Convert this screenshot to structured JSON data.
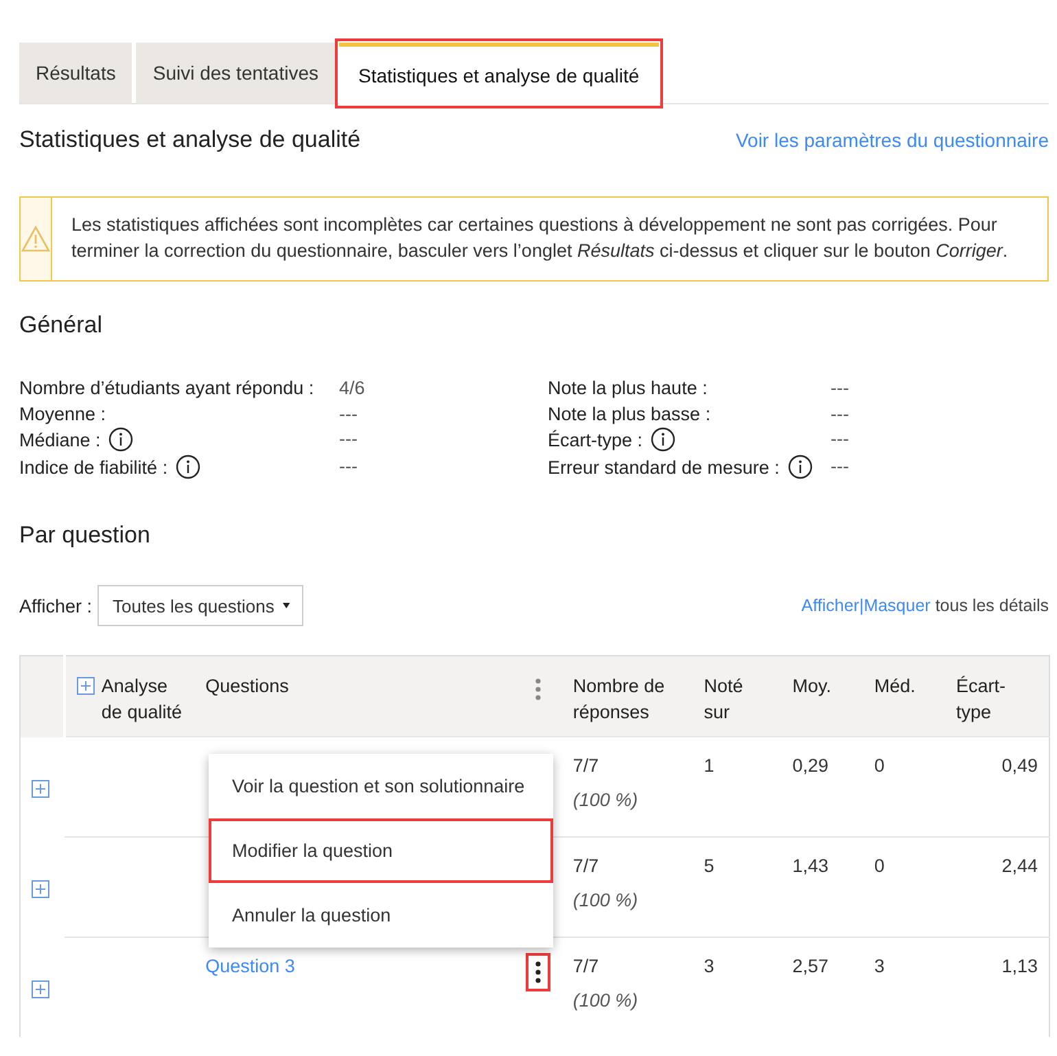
{
  "tabs": [
    {
      "label": "Résultats",
      "selected": false,
      "highlighted": false
    },
    {
      "label": "Suivi des tentatives",
      "selected": false,
      "highlighted": false
    },
    {
      "label": "Statistiques et analyse de qualité",
      "selected": true,
      "highlighted": true
    }
  ],
  "page": {
    "title": "Statistiques et analyse de qualité",
    "settings_link": "Voir les paramètres du questionnaire"
  },
  "warning": {
    "text": "Les statistiques affichées sont incomplètes car certaines questions à développement ne sont pas corrigées. Pour terminer la correction du questionnaire, basculer vers l’onglet *Résultats* ci-dessus et cliquer sur le bouton *Corriger*."
  },
  "general": {
    "heading": "Général",
    "left": [
      {
        "label": "Nombre d’étudiants ayant répondu :",
        "value": "4/6"
      },
      {
        "label": "Moyenne :",
        "value": "---"
      },
      {
        "label": "Médiane :",
        "value": "---",
        "info": true
      },
      {
        "label": "Indice de fiabilité :",
        "value": "---",
        "info": true
      }
    ],
    "right": [
      {
        "label": "Note la plus haute :",
        "value": "---"
      },
      {
        "label": "Note la plus basse :",
        "value": "---"
      },
      {
        "label": "Écart-type :",
        "value": "---",
        "info": true
      },
      {
        "label": "Erreur standard de mesure :",
        "value": "---",
        "info": true
      }
    ]
  },
  "per_question": {
    "heading": "Par question",
    "filter_label": "Afficher :",
    "filter_value": "Toutes les questions",
    "show_link": "Afficher",
    "separator": "|",
    "hide_link": "Masquer",
    "details_text": "tous les détails"
  },
  "table": {
    "columns": [
      "Analyse de qualité",
      "Questions",
      "Nombre de réponses",
      "Noté sur",
      "Moy.",
      "Méd.",
      "Écart-type"
    ],
    "rows": [
      {
        "responses": "7/7",
        "percent": "(100 %)",
        "out_of": "1",
        "mean": "0,29",
        "median": "0",
        "std_dev": "0,49"
      },
      {
        "responses": "7/7",
        "percent": "(100 %)",
        "out_of": "5",
        "mean": "1,43",
        "median": "0",
        "std_dev": "2,44"
      },
      {
        "question": "Question 3",
        "menu_open": true,
        "responses": "7/7",
        "percent": "(100 %)",
        "out_of": "3",
        "mean": "2,57",
        "median": "3",
        "std_dev": "1,13"
      }
    ],
    "context_menu": [
      {
        "label": "Voir la question et son solutionnaire",
        "highlighted": false
      },
      {
        "label": "Modifier la question",
        "highlighted": true
      },
      {
        "label": "Annuler la question",
        "highlighted": false
      }
    ]
  }
}
